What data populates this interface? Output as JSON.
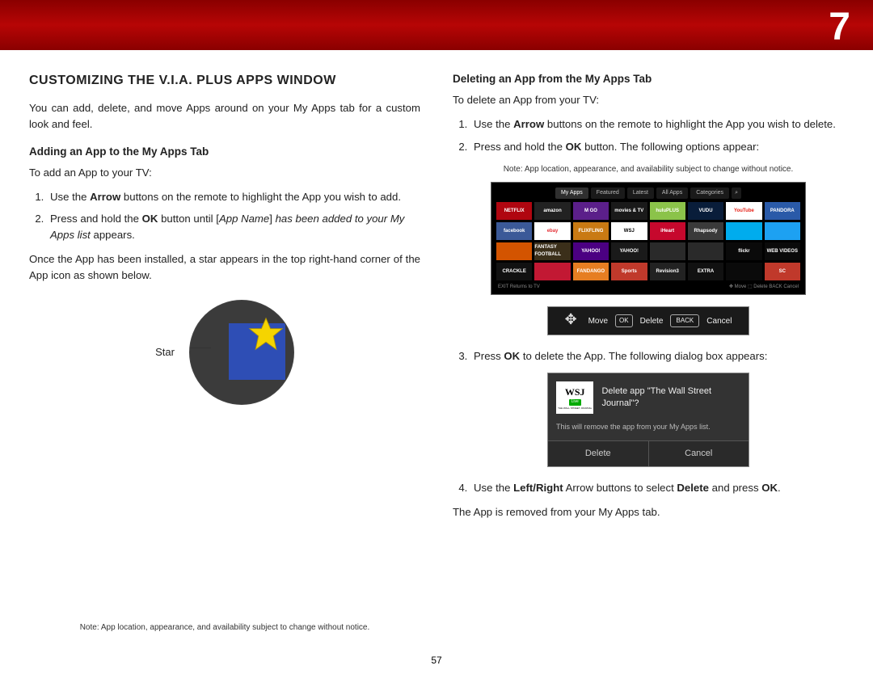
{
  "chapter": "7",
  "pageNumber": "57",
  "left": {
    "title": "CUSTOMIZING THE V.I.A. PLUS APPS WINDOW",
    "intro": "You can add, delete, and move Apps around on your My Apps tab for a custom look and feel.",
    "addHeading": "Adding an App to the My Apps Tab",
    "addIntro": "To add an App to your TV:",
    "addStep1_a": "Use the ",
    "addStep1_b": "Arrow",
    "addStep1_c": " buttons on the remote to highlight the App you wish to add.",
    "addStep2_a": "Press and hold the ",
    "addStep2_b": "OK",
    "addStep2_c": " button until [",
    "addStep2_d": "App Name",
    "addStep2_e": "] ",
    "addStep2_f": "has been added to your My Apps list",
    "addStep2_g": " appears.",
    "addAfter": "Once the App has been installed, a star appears in the top right-hand corner of the App icon as shown below.",
    "starLabel": "Star",
    "note": "Note: App location, appearance, and availability subject to change without notice."
  },
  "right": {
    "delHeading": "Deleting an App from the My Apps Tab",
    "delIntro": "To delete an App from your TV:",
    "delStep1_a": "Use the ",
    "delStep1_b": "Arrow",
    "delStep1_c": " buttons on the remote to highlight the App you wish to delete.",
    "delStep2_a": "Press and hold the ",
    "delStep2_b": "OK",
    "delStep2_c": " button. The following options appear:",
    "noteTop": "Note: App location, appearance, and availability subject to change without notice.",
    "tabs": [
      "My Apps",
      "Featured",
      "Latest",
      "All Apps",
      "Categories"
    ],
    "apps": [
      [
        {
          "t": "NETFLIX",
          "c": "#b00610"
        },
        {
          "t": "amazon",
          "c": "#222"
        },
        {
          "t": "M GO",
          "c": "#5b1f8a"
        },
        {
          "t": "movies & TV",
          "c": "#1a1a1a"
        },
        {
          "t": "huluPLUS",
          "c": "#8bc34a"
        },
        {
          "t": "VUDU",
          "c": "#091d3a"
        },
        {
          "t": "YouTube",
          "c": "#fff",
          "fg": "#e62117"
        },
        {
          "t": "PANDORA",
          "c": "#2a5aa8"
        }
      ],
      [
        {
          "t": "facebook",
          "c": "#3b5998"
        },
        {
          "t": "ebay",
          "c": "#fff",
          "fg": "#e53238"
        },
        {
          "t": "FLIXFLING",
          "c": "#c97a13"
        },
        {
          "t": "WSJ",
          "c": "#fff",
          "fg": "#000"
        },
        {
          "t": "iHeart",
          "c": "#c6082d"
        },
        {
          "t": "Rhapsody",
          "c": "#3a3a3a"
        },
        {
          "t": "",
          "c": "#00aced"
        },
        {
          "t": "",
          "c": "#1da1f2"
        }
      ],
      [
        {
          "t": "",
          "c": "#d35400"
        },
        {
          "t": "FANTASY FOOTBALL",
          "c": "#3b2f1a"
        },
        {
          "t": "YAHOO!",
          "c": "#4b0082"
        },
        {
          "t": "YAHOO!",
          "c": "#1a1a1a"
        },
        {
          "t": "",
          "c": "#2a2a2a"
        },
        {
          "t": "",
          "c": "#2a2a2a"
        },
        {
          "t": "flickr",
          "c": "#0a0a0a"
        },
        {
          "t": "WEB VIDEOS",
          "c": "#0a0a0a"
        }
      ],
      [
        {
          "t": "CRACKLE",
          "c": "#111"
        },
        {
          "t": "",
          "c": "#c21833"
        },
        {
          "t": "FANDANGO",
          "c": "#e67e22"
        },
        {
          "t": "Sports",
          "c": "#c0392b"
        },
        {
          "t": "Revision3",
          "c": "#222"
        },
        {
          "t": "EXTRA",
          "c": "#111"
        },
        {
          "t": "",
          "c": "#0a0a0a"
        },
        {
          "t": "SC",
          "c": "#c0392b"
        }
      ]
    ],
    "footLeft": "EXIT Returns to TV",
    "footRight": "✥ Move  ⬚ Delete  BACK Cancel",
    "controls": {
      "move": "Move",
      "ok": "OK",
      "delete": "Delete",
      "back": "BACK",
      "cancel": "Cancel"
    },
    "delStep3_a": "Press ",
    "delStep3_b": "OK",
    "delStep3_c": " to delete the App. The following dialog box appears:",
    "dialog": {
      "wsj": "WSJ",
      "live": "Live",
      "wsjsub": "THE WALL STREET JOURNAL",
      "q": "Delete app \"The Wall Street Journal\"?",
      "msg": "This will remove the app from your My Apps list.",
      "del": "Delete",
      "cancel": "Cancel"
    },
    "delStep4_a": "Use the ",
    "delStep4_b": "Left/Right",
    "delStep4_c": " Arrow buttons to select ",
    "delStep4_d": "Delete",
    "delStep4_e": " and press ",
    "delStep4_f": "OK",
    "delStep4_g": ".",
    "delAfter": "The App is removed from your My Apps tab."
  }
}
